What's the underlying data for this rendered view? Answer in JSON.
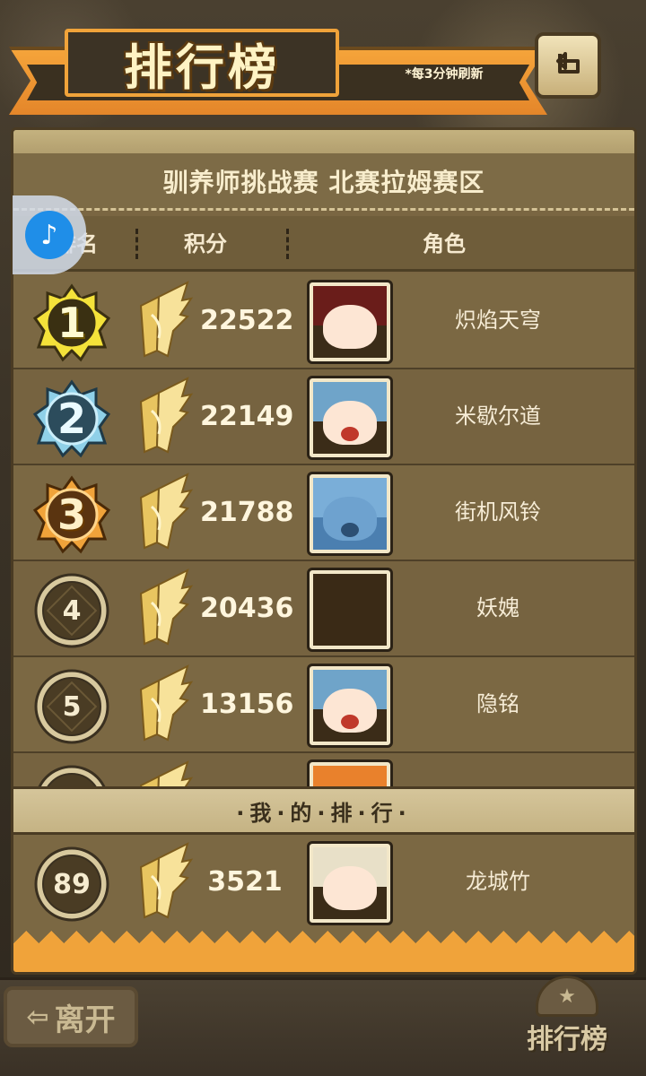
{
  "header": {
    "title": "排行榜",
    "refresh_note": "*每3分钟刷新",
    "back_icon": "return-arrow-icon"
  },
  "panel": {
    "subtitle": "驯养师挑战赛 北赛拉姆赛区",
    "columns": {
      "rank": "排名",
      "score": "积分",
      "role": "角色"
    }
  },
  "rows": [
    {
      "rank": "1",
      "tier": "gold",
      "score": "22522",
      "role": "炽焰天穹",
      "avatar": "red-hair"
    },
    {
      "rank": "2",
      "tier": "silver",
      "score": "22149",
      "role": "米歇尔道",
      "avatar": "blue-hair"
    },
    {
      "rank": "3",
      "tier": "bronze",
      "score": "21788",
      "role": "街机风铃",
      "avatar": "blue-face"
    },
    {
      "rank": "4",
      "tier": "normal",
      "score": "20436",
      "role": "妖媿",
      "avatar": "empty"
    },
    {
      "rank": "5",
      "tier": "normal",
      "score": "13156",
      "role": "隐铭",
      "avatar": "blue-hair"
    },
    {
      "rank": "",
      "tier": "normal",
      "score": "",
      "role": "",
      "avatar": "orange-hat"
    }
  ],
  "my_rank": {
    "label": "·我·的·排·行·",
    "rank": "89",
    "score": "3521",
    "role": "龙城竹"
  },
  "footer": {
    "leave_label": "离开",
    "ranking_label": "排行榜"
  },
  "colors": {
    "gold": "#f4e23a",
    "silver": "#8fd0e8",
    "bronze": "#f0a33a",
    "panel": "#7a6642"
  }
}
